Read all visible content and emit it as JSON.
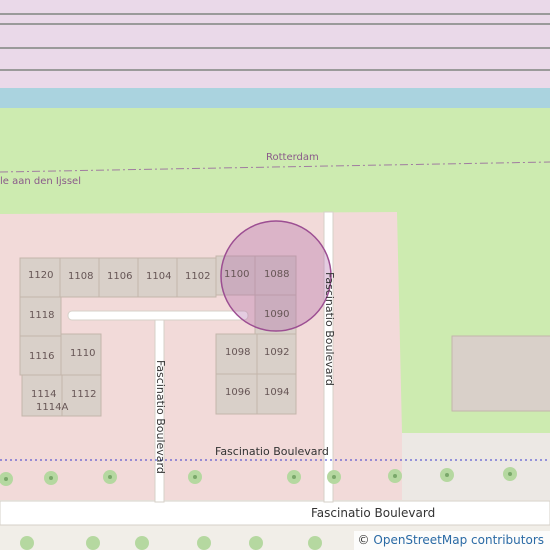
{
  "map": {
    "colors": {
      "railway_bg": "#ead9e9",
      "water": "#aad3df",
      "grass": "#cdebb0",
      "residential": "#f2dad9",
      "building": "#d9d0c9",
      "building_stroke": "#c4b6ab",
      "road": "#ffffff",
      "admin_border": "#a07ca0",
      "highlight": "#b26ea8",
      "tree": "#b5d8a0"
    },
    "admin_labels": {
      "rotterdam": "Rotterdam",
      "capelle": "le aan den Ijssel"
    },
    "road_labels": {
      "vertical_left": "Fascinatio Boulevard",
      "vertical_right": "Fascinatio Boulevard",
      "horizontal_mid": "Fascinatio Boulevard",
      "horizontal_bottom": "Fascinatio Boulevard"
    },
    "house_numbers": {
      "n1120": "1120",
      "n1108": "1108",
      "n1106": "1106",
      "n1104": "1104",
      "n1102": "1102",
      "n1100": "1100",
      "n1088": "1088",
      "n1118": "1118",
      "n1090": "1090",
      "n1116": "1116",
      "n1110": "1110",
      "n1098": "1098",
      "n1092": "1092",
      "n1114": "1114",
      "n1112": "1112",
      "n1114A": "1114A",
      "n1096": "1096",
      "n1094": "1094"
    },
    "attribution": {
      "symbol": "©",
      "text": "OpenStreetMap contributors"
    }
  }
}
